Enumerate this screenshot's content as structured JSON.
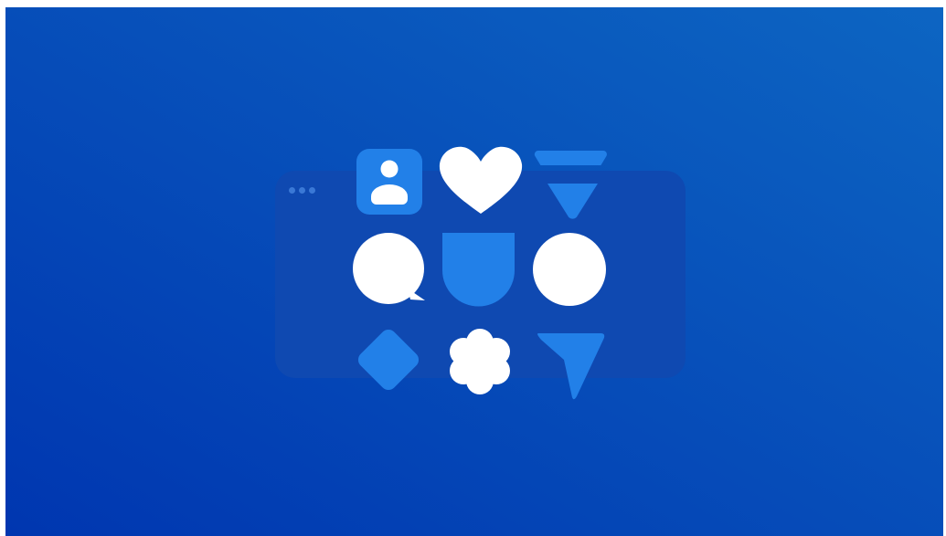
{
  "colors": {
    "background_top_right": "#0d65c2",
    "background_bottom_left": "#0036b0",
    "window_fill": "#0f49b1",
    "window_dot": "#3a78d6",
    "shape_white": "#ffffff",
    "shape_blue": "#2280e8"
  },
  "window": {
    "dots": [
      {
        "name": "window-dot-1"
      },
      {
        "name": "window-dot-2"
      },
      {
        "name": "window-dot-3"
      }
    ]
  },
  "icon_grid": [
    {
      "name": "user-profile-icon",
      "color": "blue"
    },
    {
      "name": "heart-icon",
      "color": "white"
    },
    {
      "name": "funnel-icon",
      "color": "blue"
    },
    {
      "name": "speech-bubble-icon",
      "color": "white"
    },
    {
      "name": "shield-icon",
      "color": "blue"
    },
    {
      "name": "circle-icon",
      "color": "white"
    },
    {
      "name": "diamond-icon",
      "color": "blue"
    },
    {
      "name": "flower-icon",
      "color": "white"
    },
    {
      "name": "pointer-icon",
      "color": "blue"
    }
  ]
}
